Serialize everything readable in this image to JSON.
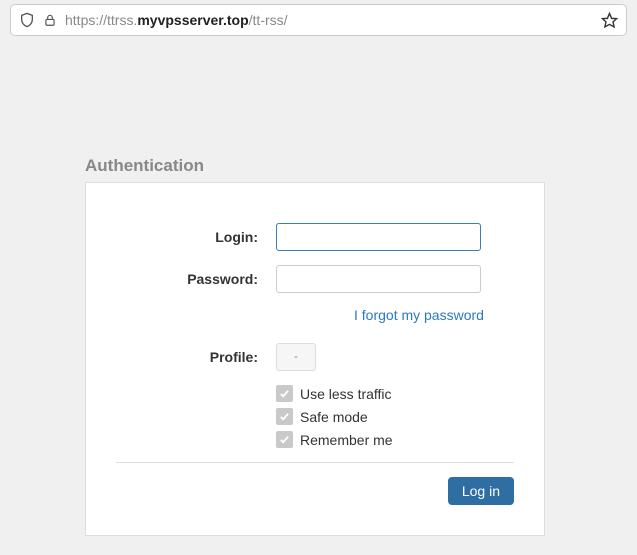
{
  "address_bar": {
    "url_prefix": "https://ttrss.",
    "url_domain": "myvpsserver.top",
    "url_path": "/tt-rss/"
  },
  "panel": {
    "title": "Authentication",
    "login_label": "Login:",
    "password_label": "Password:",
    "forgot_link": "I forgot my password",
    "profile_label": "Profile:",
    "profile_selected": "-",
    "check_useless": "Use less traffic",
    "check_safemode": "Safe mode",
    "check_remember": "Remember me",
    "login_button": "Log in"
  }
}
